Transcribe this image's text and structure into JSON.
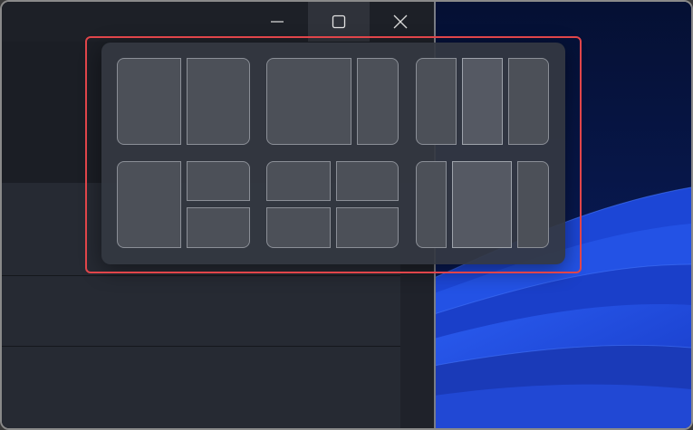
{
  "window": {
    "controls": [
      {
        "name": "minimize",
        "icon": "minimize-icon"
      },
      {
        "name": "maximize",
        "icon": "maximize-icon"
      },
      {
        "name": "close",
        "icon": "close-icon"
      }
    ]
  },
  "snap_layouts": {
    "layouts": [
      {
        "id": "two-equal",
        "zones": 2
      },
      {
        "id": "two-wide-left",
        "zones": 2
      },
      {
        "id": "three-columns",
        "zones": 3
      },
      {
        "id": "left-plus-two-stacked",
        "zones": 3
      },
      {
        "id": "four-quadrants",
        "zones": 4
      },
      {
        "id": "narrow-wide-narrow",
        "zones": 3
      }
    ]
  },
  "colors": {
    "highlight": "#e0454a",
    "wallpaper_blue": "#1f4ed8",
    "flyout_bg": "#343842"
  }
}
